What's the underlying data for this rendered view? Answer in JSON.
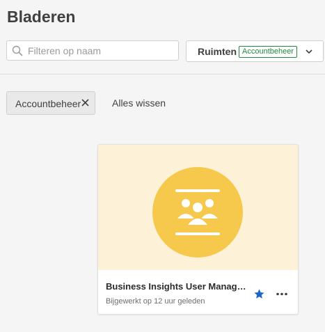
{
  "header": {
    "title": "Bladeren",
    "search_placeholder": "Filteren op naam",
    "spaces_label": "Ruimten",
    "spaces_badge": "Accountbeheer"
  },
  "filters": {
    "chip_label": "Accountbeheer",
    "clear_all": "Alles wissen"
  },
  "card": {
    "title": "Business Insights User Manage...",
    "subtitle": "Bijgewerkt op 12 uur geleden",
    "icon": "people-presentation-icon",
    "starred": true
  },
  "colors": {
    "badge": "#1f8a3b",
    "thumb_bg": "#fdf2d8",
    "thumb_circle": "#f6c94c",
    "star": "#1a66c4"
  }
}
